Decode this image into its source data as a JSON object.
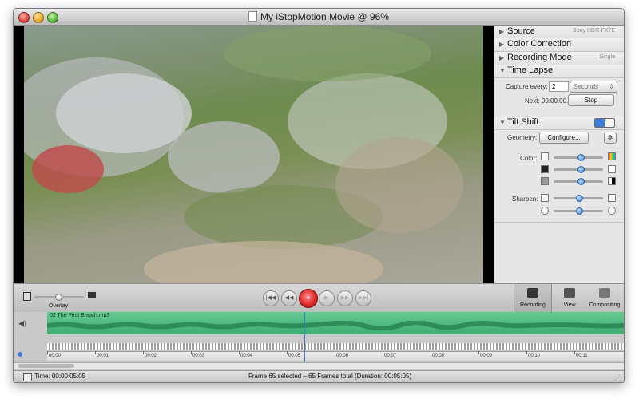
{
  "window": {
    "title": "My iStopMotion Movie @ 96%"
  },
  "panel": {
    "source": {
      "label": "Source",
      "value": "Sony HDR-FX7E"
    },
    "color_correction": {
      "label": "Color Correction"
    },
    "recording_mode": {
      "label": "Recording Mode",
      "value": "Single"
    },
    "time_lapse": {
      "label": "Time Lapse",
      "capture_every_label": "Capture every:",
      "capture_value": "2",
      "capture_unit": "Seconds",
      "next_label": "Next: 00:00:00.0",
      "stop_label": "Stop"
    },
    "tilt_shift": {
      "label": "Tilt Shift",
      "geometry_label": "Geometry:",
      "configure_label": "Configure...",
      "color_label": "Color:",
      "sharpen_label": "Sharpen:",
      "sliders": {
        "color1": 0.55,
        "color2": 0.55,
        "color3": 0.55,
        "sharpen1": 0.52,
        "sharpen2": 0.52
      }
    }
  },
  "toolbar": {
    "overlay_label": "Overlay",
    "modes": [
      {
        "label": "Recording",
        "selected": true
      },
      {
        "label": "View",
        "selected": false
      },
      {
        "label": "Compositing",
        "selected": false
      }
    ]
  },
  "timeline": {
    "audio_name": "02 The First Breath.mp3",
    "ticks": [
      "00:00",
      "00:01",
      "00:02",
      "00:03",
      "00:04",
      "00:05",
      "00:06",
      "00:07",
      "00:08",
      "00:09",
      "00:10",
      "00:11"
    ]
  },
  "status": {
    "time": "Time: 00:00:05:05",
    "frames": "Frame 65 selected – 65 Frames total (Duration: 00:05:05)"
  },
  "colors": {
    "accent": "#3a7ed8",
    "audio": "#4fbb80",
    "record": "#e02a2a"
  }
}
